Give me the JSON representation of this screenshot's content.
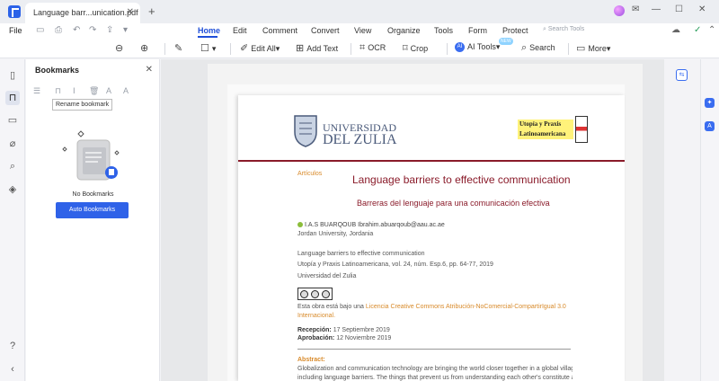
{
  "tab": {
    "title": "Language  barr...unication.pdf",
    "close": "✕",
    "new": "+"
  },
  "window": {
    "minimize": "—",
    "maximize": "☐",
    "close": "✕"
  },
  "menu": {
    "file": "File",
    "items": [
      "Home",
      "Edit",
      "Comment",
      "Convert",
      "View",
      "Organize",
      "Tools",
      "Form",
      "Protect"
    ],
    "active": "Home",
    "search_tools": "Search Tools"
  },
  "toolbar": {
    "edit_all": "Edit All",
    "add_text": "Add Text",
    "ocr": "OCR",
    "crop": "Crop",
    "ai_tools": "AI Tools",
    "search": "Search",
    "more": "More"
  },
  "bookmarks": {
    "title": "Bookmarks",
    "tooltip": "Rename bookmark",
    "empty": "No Bookmarks",
    "auto_button": "Auto Bookmarks"
  },
  "document": {
    "univ_line1": "UNIVERSIDAD",
    "univ_line2": "DEL ZULIA",
    "utopia_line1": "Utopía y Praxis",
    "utopia_line2": "Latinoamericana",
    "section": "Artículos",
    "title_en": "Language barriers to effective communication",
    "title_es": "Barreras del lenguaje para una comunicación efectiva",
    "author_name": "I.A.S BUARQOUB",
    "author_email": "Ibrahim.abuarqoub@aau.ac.ae",
    "affiliation": "Jordan University, Jordania",
    "ref_title": "Language barriers to effective communication",
    "journal": "Utopía y Praxis Latinoamericana, vol. 24, núm. Esp.6, pp. 64-77, 2019",
    "publisher": "Universidad del Zulia",
    "license_prefix": "Esta obra está bajo una ",
    "license_link": "Licencia Creative Commons Atribución-NoComercial-CompartirIgual 3.0 Internacional.",
    "reception_label": "Recepción:",
    "reception_date": "17 Septiembre 2019",
    "approval_label": "Aprobación:",
    "approval_date": "12 Noviembre 2019",
    "abstract_heading": "Abstract:",
    "abstract_line1": "Globalization and communication technology are bringing the world closer together in a global village,",
    "abstract_line2": "including language barriers. The things that prevent us from understanding each other's constitute a"
  },
  "colors": {
    "accent": "#2f62e8",
    "maroon": "#8a1b2a",
    "orange": "#d88a2a"
  }
}
